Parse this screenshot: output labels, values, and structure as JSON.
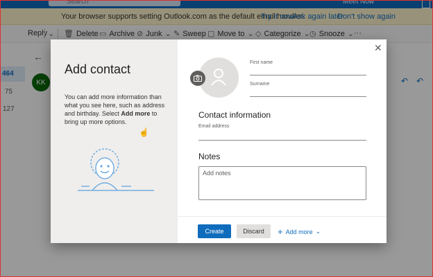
{
  "topbar": {
    "search_placeholder": "Search",
    "meet_now": "Meet Now"
  },
  "infobar": {
    "message": "Your browser supports setting Outlook.com as the default email handler.",
    "try_it_now": "Try it now",
    "ask_again_later": "Ask again later",
    "dont_show_again": "Don't show again"
  },
  "toolbar": {
    "reply": "Reply",
    "delete": "Delete",
    "archive": "Archive",
    "junk": "Junk",
    "sweep": "Sweep",
    "move_to": "Move to",
    "categorize": "Categorize",
    "snooze": "Snooze",
    "more": "···"
  },
  "leftrail": {
    "counts": [
      "464",
      "75",
      "127"
    ]
  },
  "message": {
    "sender_initials": "KK"
  },
  "dialog": {
    "title": "Add contact",
    "description_prefix": "You can add more information than what you see here, such as address and birthday. Select ",
    "description_bold": "Add more",
    "description_suffix": " to bring up more options.",
    "first_name_label": "First name",
    "surname_label": "Surname",
    "contact_info_heading": "Contact information",
    "email_label": "Email address",
    "notes_heading": "Notes",
    "notes_placeholder": "Add notes",
    "create_button": "Create",
    "discard_button": "Discard",
    "add_more_button": "Add more",
    "close_icon": "close-icon",
    "camera_icon": "camera-icon"
  },
  "colors": {
    "accent": "#0f6cbd",
    "infobar": "#fff4ce",
    "avatar": "#0b6a0b"
  }
}
